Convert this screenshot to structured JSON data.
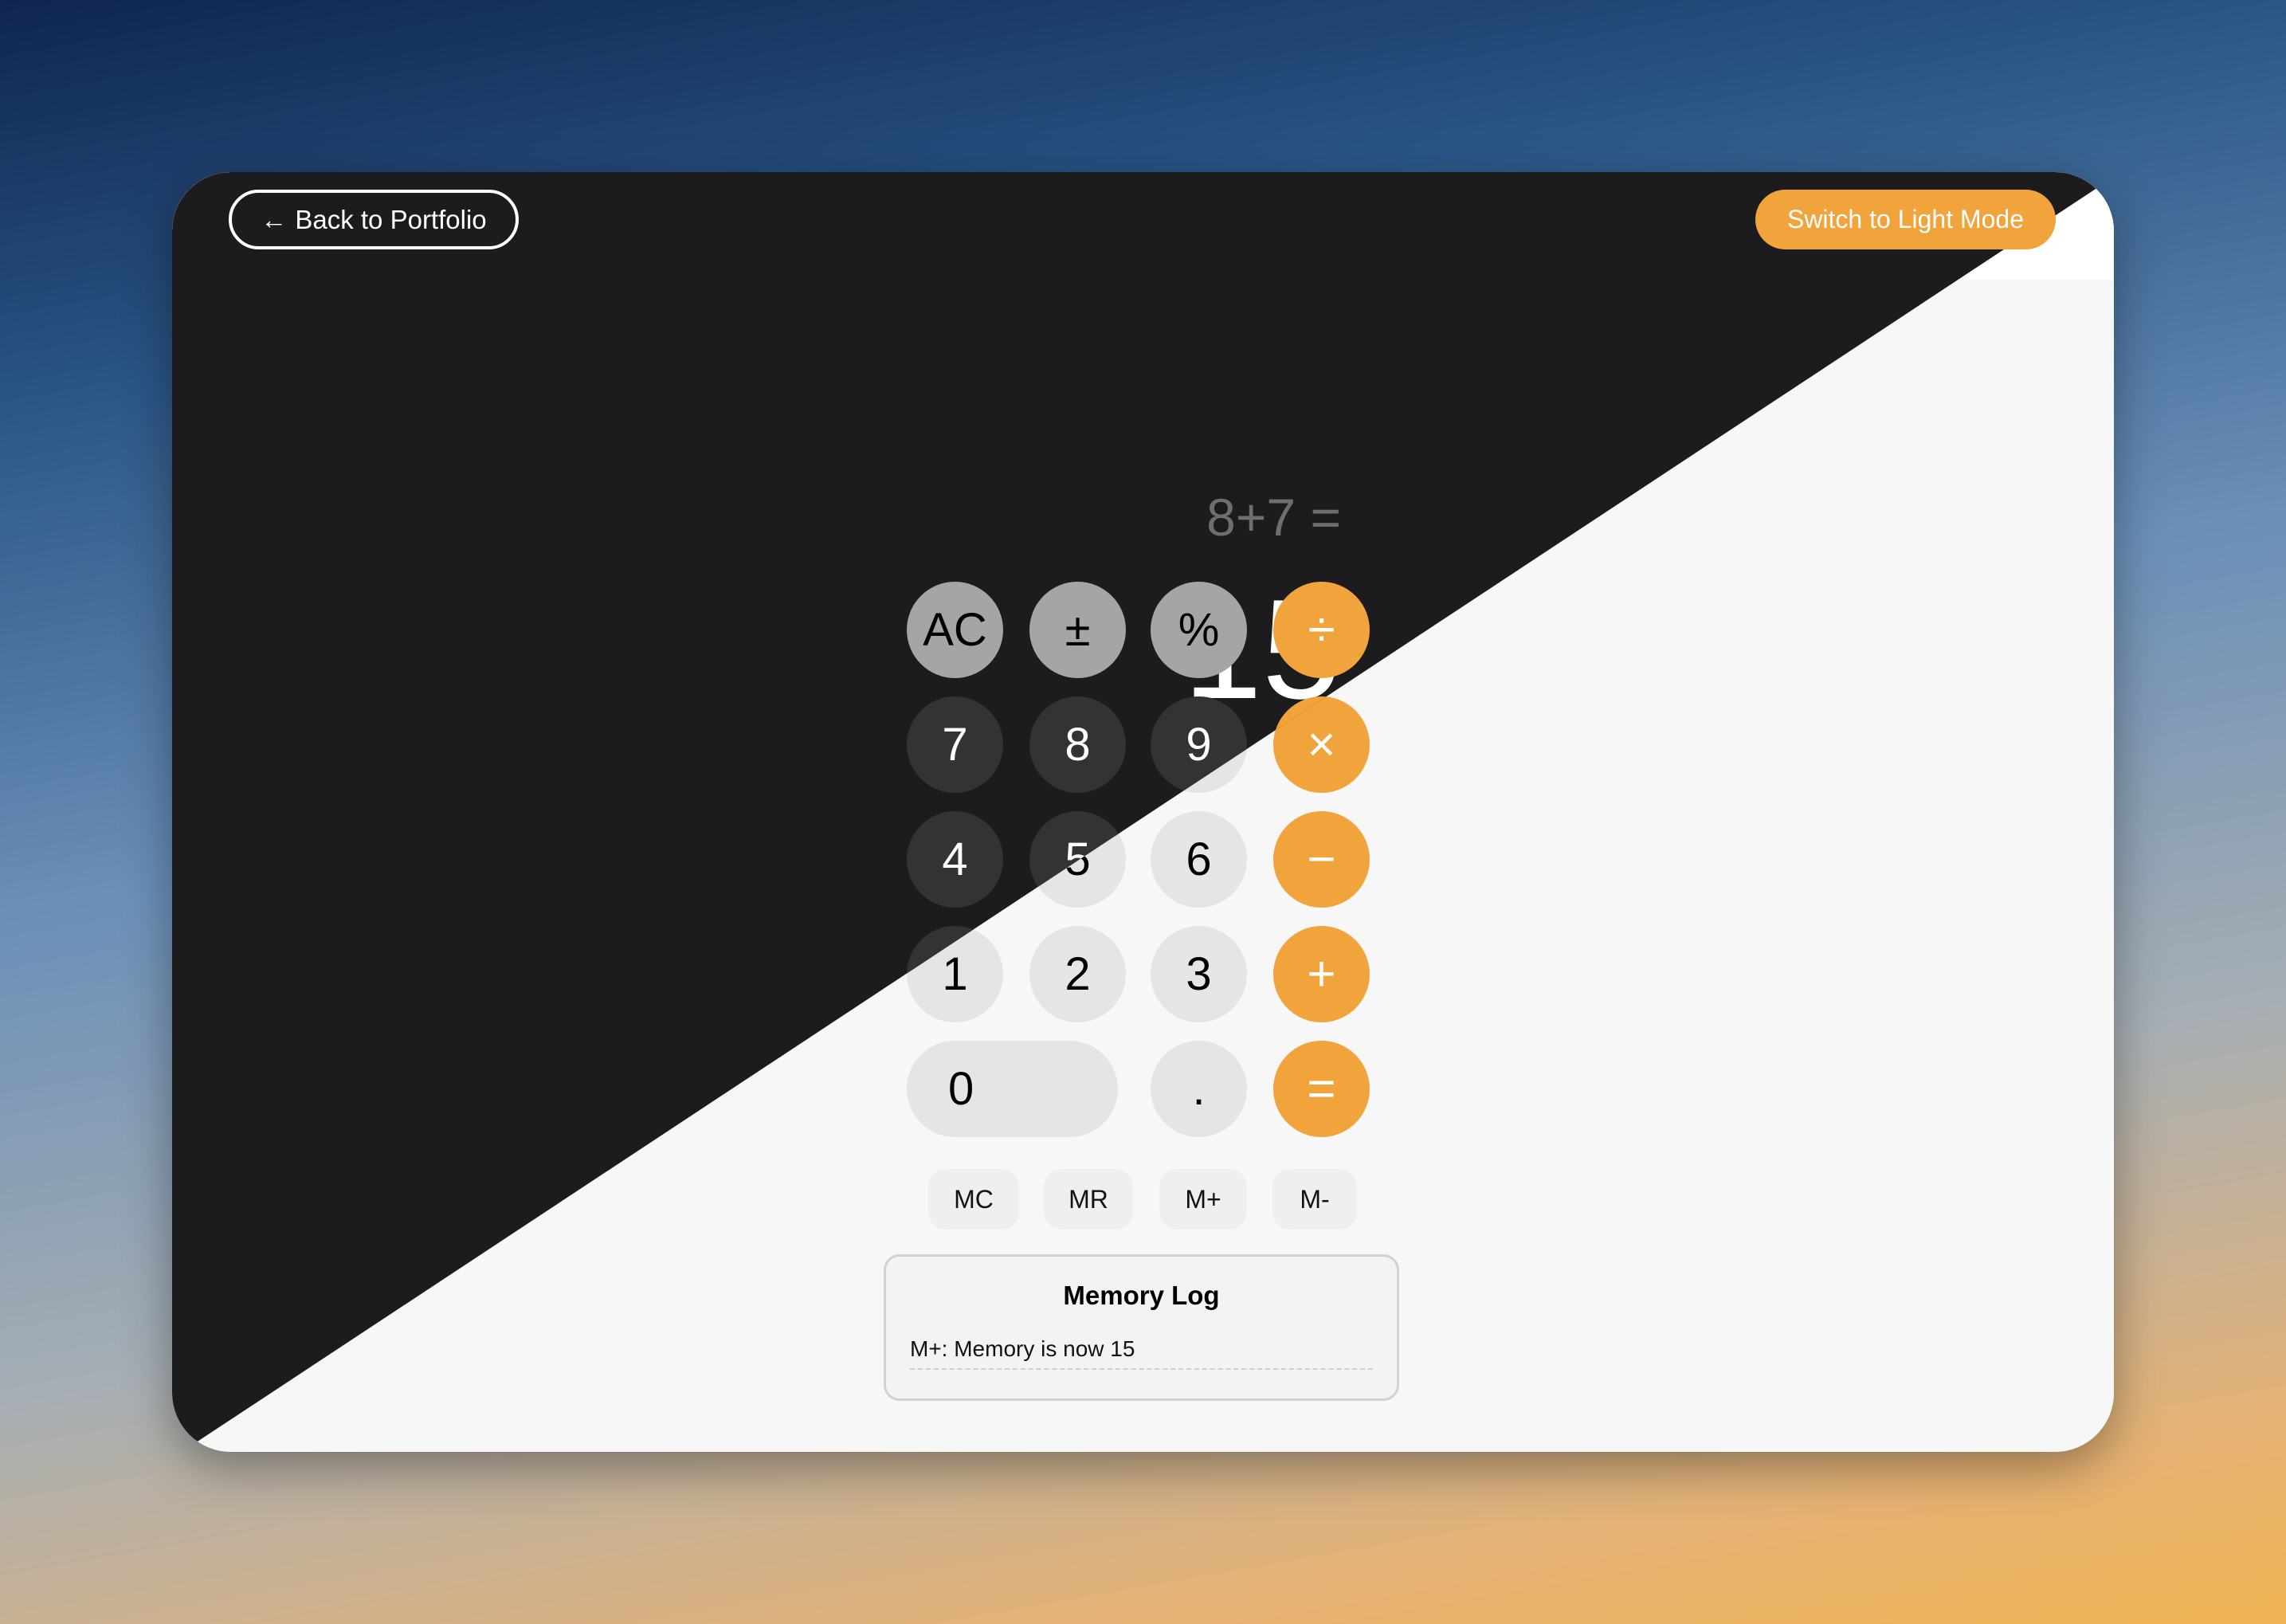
{
  "header": {
    "back_label": "Back to Portfolio",
    "back_icon": "arrow-left-icon",
    "mode_label": "Switch to Light Mode"
  },
  "display": {
    "expression": "8+7 =",
    "result": "15"
  },
  "keypad": {
    "rows": [
      [
        {
          "label": "AC",
          "type": "func"
        },
        {
          "label": "±",
          "type": "func"
        },
        {
          "label": "%",
          "type": "func"
        },
        {
          "label": "÷",
          "type": "op"
        }
      ],
      [
        {
          "label": "7",
          "type": "digit"
        },
        {
          "label": "8",
          "type": "digit"
        },
        {
          "label": "9",
          "type": "digit"
        },
        {
          "label": "×",
          "type": "op"
        }
      ],
      [
        {
          "label": "4",
          "type": "digit"
        },
        {
          "label": "5",
          "type": "digit"
        },
        {
          "label": "6",
          "type": "digit"
        },
        {
          "label": "−",
          "type": "op"
        }
      ],
      [
        {
          "label": "1",
          "type": "digit"
        },
        {
          "label": "2",
          "type": "digit"
        },
        {
          "label": "3",
          "type": "digit"
        },
        {
          "label": "+",
          "type": "op"
        }
      ],
      [
        {
          "label": "0",
          "type": "digit",
          "wide": true
        },
        {
          "label": ".",
          "type": "digit"
        },
        {
          "label": "=",
          "type": "op"
        }
      ]
    ]
  },
  "memory": {
    "buttons": [
      "MC",
      "MR",
      "M+",
      "M-"
    ]
  },
  "memory_log": {
    "title": "Memory Log",
    "entries": [
      "M+: Memory is now 15"
    ]
  },
  "colors": {
    "accent": "#f1a33c",
    "dark_bg": "#1c1c1e",
    "light_bg": "#f7f7f7"
  }
}
